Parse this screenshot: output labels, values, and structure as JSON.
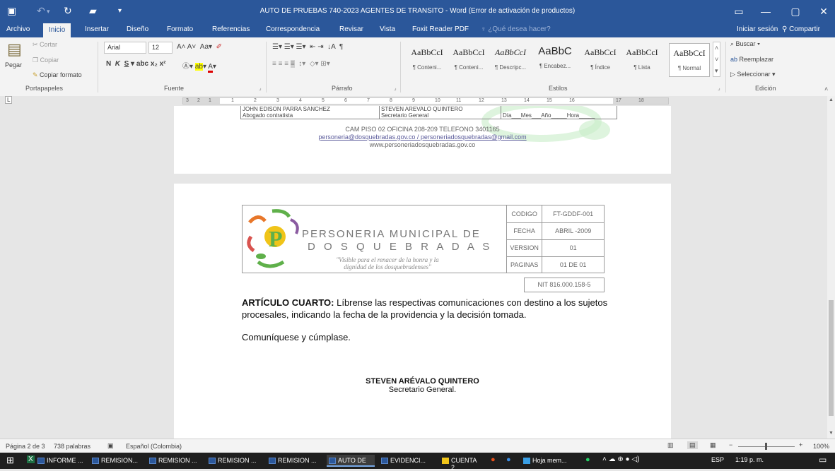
{
  "window": {
    "title": "AUTO DE PRUEBAS 740-2023 AGENTES DE TRANSITO - Word (Error de activación de productos)",
    "controls": [
      "▭",
      "—",
      "▢",
      "✕"
    ]
  },
  "menu": {
    "tabs": [
      "Archivo",
      "Inicio",
      "Insertar",
      "Diseño",
      "Formato",
      "Referencias",
      "Correspondencia",
      "Revisar",
      "Vista",
      "Foxit Reader PDF"
    ],
    "tell_me": "¿Qué desea hacer?",
    "sign_in": "Iniciar sesión",
    "share": "Compartir"
  },
  "ribbon": {
    "clipboard": {
      "paste": "Pegar",
      "cut": "Cortar",
      "copy": "Copiar",
      "format_painter": "Copiar formato",
      "label": "Portapapeles"
    },
    "font": {
      "name": "Arial",
      "size": "12",
      "label": "Fuente"
    },
    "paragraph": {
      "label": "Párrafo"
    },
    "styles": {
      "label": "Estilos",
      "items": [
        {
          "sample": "AaBbCcI",
          "name": "¶ Conteni..."
        },
        {
          "sample": "AaBbCcI",
          "name": "¶ Conteni..."
        },
        {
          "sample": "AaBbCcI",
          "name": "¶ Descripc..."
        },
        {
          "sample": "AaBbC",
          "name": "¶ Encabez..."
        },
        {
          "sample": "AaBbCcI",
          "name": "¶ Índice"
        },
        {
          "sample": "AaBbCcI",
          "name": "¶ Lista"
        },
        {
          "sample": "AaBbCcI",
          "name": "¶ Normal"
        }
      ]
    },
    "editing": {
      "find": "Buscar",
      "replace": "Reemplazar",
      "select": "Seleccionar",
      "label": "Edición"
    }
  },
  "ruler": {
    "ticks": [
      "3",
      "2",
      "1",
      "1",
      "2",
      "3",
      "4",
      "5",
      "6",
      "7",
      "8",
      "9",
      "10",
      "11",
      "12",
      "13",
      "14",
      "15",
      "16",
      "17",
      "18"
    ]
  },
  "page1": {
    "sig_left_name": "JOHN EDISON PARRA SANCHEZ",
    "sig_left_role": "Abogado contratista",
    "sig_mid_name": "STEVEN AREVALO QUINTERO",
    "sig_mid_role": "Secretario General",
    "sig_date": "Día___Mes___Año_____Hora_____",
    "footer_address": "CAM PISO 02 OFICINA 208-209 TELEFONO 3401165",
    "footer_email": "personeria@dosquebradas.gov.co / personeriadosquebradas@gmail.com",
    "footer_web": "www.personeriadosquebradas.gov.co"
  },
  "page2": {
    "header": {
      "org_line1": "PERSONERIA MUNICIPAL DE",
      "org_line2": "D O S Q U E B R A D A S",
      "slogan_line1": "\"Visible para el renacer de la honra y la",
      "slogan_line2": "dignidad de los dosquebradenses\"",
      "rows": [
        {
          "label": "CODIGO",
          "value": "FT-GDDF-001"
        },
        {
          "label": "FECHA",
          "value": "ABRIL -2009"
        },
        {
          "label": "VERSION",
          "value": "01"
        },
        {
          "label": "PAGINAS",
          "value": "01 DE 01"
        }
      ],
      "nit": "NIT 816.000.158-5"
    },
    "article_title": "ARTÍCULO CUARTO:",
    "article_body": " Líbrense las respectivas comunicaciones con destino a los sujetos procesales, indicando la fecha de la providencia y la decisión tomada.",
    "closing": "Comuníquese y cúmplase.",
    "signer_name": "STEVEN ARÉVALO QUINTERO",
    "signer_role": "Secretario General."
  },
  "status": {
    "page": "Página 2 de 3",
    "words": "738 palabras",
    "language": "Español (Colombia)",
    "zoom": "100%"
  },
  "taskbar": {
    "apps": [
      {
        "label": "INFORME ..."
      },
      {
        "label": "REMISION..."
      },
      {
        "label": "REMISION ..."
      },
      {
        "label": "REMISION ..."
      },
      {
        "label": "REMISION ..."
      },
      {
        "label": "AUTO DE ..."
      },
      {
        "label": "EVIDENCI..."
      },
      {
        "label": "CUENTA 2"
      },
      {
        "label": "Hoja mem..."
      }
    ],
    "lang": "ESP",
    "time": "1:19 p. m."
  },
  "colors": {
    "word_blue": "#2b579a",
    "logo_orange": "#e8772a",
    "logo_green": "#5fb04a",
    "logo_purple": "#8a5aa0"
  }
}
